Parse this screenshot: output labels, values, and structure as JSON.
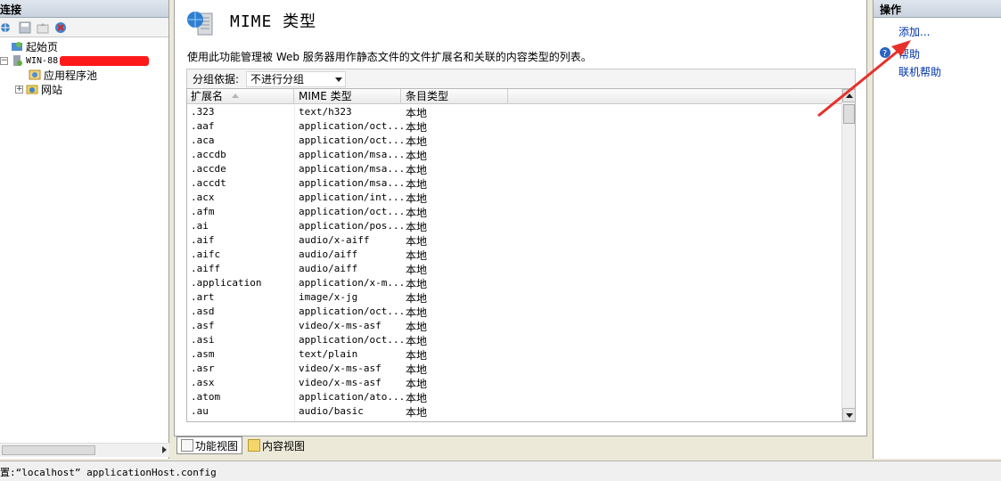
{
  "left": {
    "header": "连接",
    "tree": [
      {
        "label": "起始页"
      },
      {
        "label": "WIN-88"
      },
      {
        "label": "应用程序池"
      },
      {
        "label": "网站"
      }
    ]
  },
  "center": {
    "title": "MIME 类型",
    "description": "使用此功能管理被 Web 服务器用作静态文件的文件扩展名和关联的内容类型的列表。",
    "group_by_label": "分组依据:",
    "group_by_value": "不进行分组",
    "columns": [
      "扩展名",
      "MIME 类型",
      "条目类型"
    ],
    "rows": [
      [
        ".323",
        "text/h323",
        "本地"
      ],
      [
        ".aaf",
        "application/oct...",
        "本地"
      ],
      [
        ".aca",
        "application/oct...",
        "本地"
      ],
      [
        ".accdb",
        "application/msa...",
        "本地"
      ],
      [
        ".accde",
        "application/msa...",
        "本地"
      ],
      [
        ".accdt",
        "application/msa...",
        "本地"
      ],
      [
        ".acx",
        "application/int...",
        "本地"
      ],
      [
        ".afm",
        "application/oct...",
        "本地"
      ],
      [
        ".ai",
        "application/pos...",
        "本地"
      ],
      [
        ".aif",
        "audio/x-aiff",
        "本地"
      ],
      [
        ".aifc",
        "audio/aiff",
        "本地"
      ],
      [
        ".aiff",
        "audio/aiff",
        "本地"
      ],
      [
        ".application",
        "application/x-m...",
        "本地"
      ],
      [
        ".art",
        "image/x-jg",
        "本地"
      ],
      [
        ".asd",
        "application/oct...",
        "本地"
      ],
      [
        ".asf",
        "video/x-ms-asf",
        "本地"
      ],
      [
        ".asi",
        "application/oct...",
        "本地"
      ],
      [
        ".asm",
        "text/plain",
        "本地"
      ],
      [
        ".asr",
        "video/x-ms-asf",
        "本地"
      ],
      [
        ".asx",
        "video/x-ms-asf",
        "本地"
      ],
      [
        ".atom",
        "application/ato...",
        "本地"
      ],
      [
        ".au",
        "audio/basic",
        "本地"
      ]
    ],
    "view_tabs": [
      "功能视图",
      "内容视图"
    ]
  },
  "right": {
    "header": "操作",
    "actions": [
      "添加...",
      "帮助",
      "联机帮助"
    ]
  },
  "status": "置:“localhost” applicationHost.config",
  "colors": {
    "link": "#0033aa",
    "annotation_arrow": "#e8302a",
    "redaction": "#ff1a1a"
  }
}
